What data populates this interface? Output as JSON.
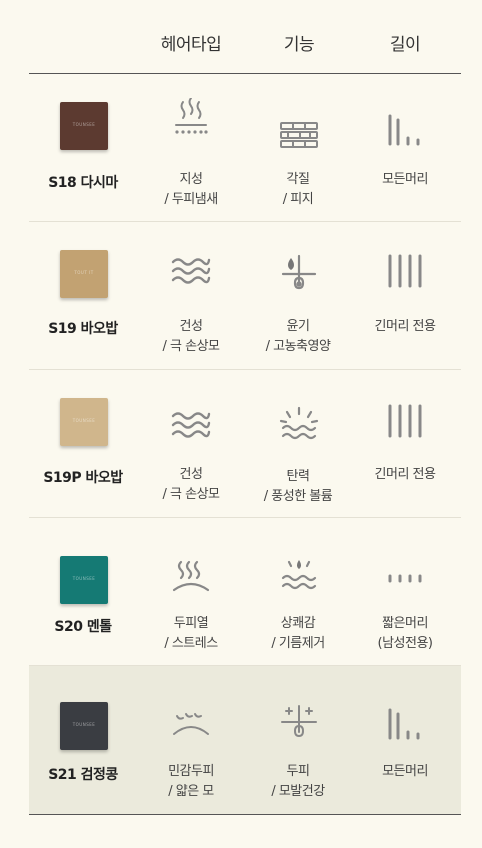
{
  "header": {
    "hair_type": "헤어타입",
    "function": "기능",
    "length": "길이"
  },
  "products": [
    {
      "name": "S18 다시마",
      "soap_color": "#5c3a30",
      "soap_label": "TOUNSEE",
      "hair_icon": "steam-dots-icon",
      "hair_line1": "지성",
      "hair_line2": "/ 두피냄새",
      "func_icon": "layers-icon",
      "func_line1": "각질",
      "func_line2": "/ 피지",
      "length_icon": "length-all-icon",
      "length_line1": "모든머리"
    },
    {
      "name": "S19 바오밥",
      "soap_color": "#c2a272",
      "soap_label": "TOUT IT",
      "hair_icon": "wave-icon",
      "hair_line1": "건성",
      "hair_line2": "/ 극 손상모",
      "func_icon": "hair-drop-icon",
      "func_line1": "윤기",
      "func_line2": "/ 고농축영양",
      "length_icon": "length-long-icon",
      "length_line1": "긴머리 전용"
    },
    {
      "name": "S19P 바오밥",
      "soap_color": "#d0b68c",
      "soap_label": "TOUNSEE",
      "hair_icon": "wave-icon",
      "hair_line1": "건성",
      "hair_line2": "/ 극 손상모",
      "func_icon": "sun-wave-icon",
      "func_line1": "탄력",
      "func_line2": "/ 풍성한 볼륨",
      "length_icon": "length-long-icon",
      "length_line1": "긴머리 전용"
    },
    {
      "name": "S20 멘톨",
      "soap_color": "#157a74",
      "soap_label": "TOUNSEE",
      "hair_icon": "heat-arc-icon",
      "hair_line1": "두피열",
      "hair_line2": "/ 스트레스",
      "func_icon": "drop-wave-icon",
      "func_line1": "상쾌감",
      "func_line2": "/ 기름제거",
      "length_icon": "length-short-icon",
      "length_line1": "짧은머리",
      "length_line2": "(남성전용)"
    },
    {
      "name": "S21 검정콩",
      "soap_color": "#3a3d42",
      "soap_label": "TOUNSEE",
      "hair_icon": "sensitive-icon",
      "hair_line1": "민감두피",
      "hair_line2": "/ 얇은 모",
      "func_icon": "root-sparkle-icon",
      "func_line1": "두피",
      "func_line2": "/ 모발건강",
      "length_icon": "length-all-icon",
      "length_line1": "모든머리"
    }
  ]
}
